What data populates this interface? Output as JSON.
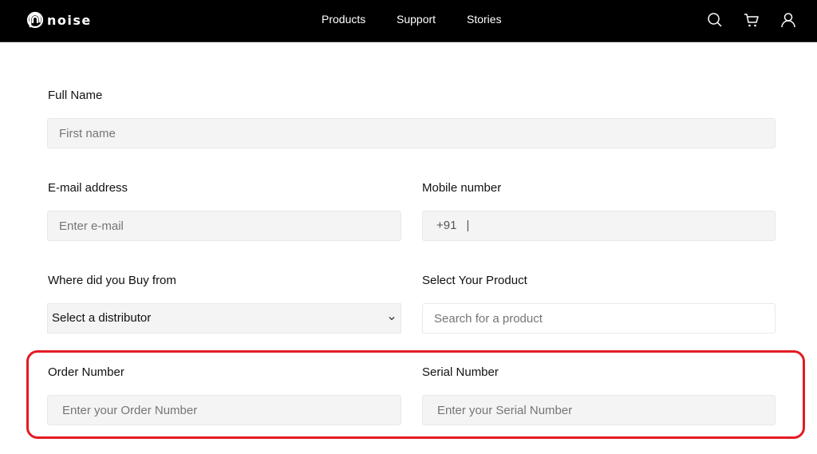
{
  "header": {
    "brand": "noise",
    "nav": [
      "Products",
      "Support",
      "Stories"
    ],
    "icons": [
      "search-icon",
      "cart-icon",
      "user-icon"
    ]
  },
  "form": {
    "full_name": {
      "label": "Full Name",
      "placeholder": "First name"
    },
    "email": {
      "label": "E-mail address",
      "placeholder": "Enter e-mail"
    },
    "mobile": {
      "label": "Mobile number",
      "prefix": "+91",
      "caret": "|"
    },
    "distributor": {
      "label": "Where did you Buy from",
      "selected": "Select a distributor"
    },
    "product": {
      "label": "Select Your Product",
      "placeholder": "Search for a product"
    },
    "order_number": {
      "label": "Order Number",
      "placeholder": "Enter your Order Number"
    },
    "serial_number": {
      "label": "Serial Number",
      "placeholder": "Enter your Serial Number"
    }
  },
  "colors": {
    "header_bg": "#000000",
    "field_bg": "#f4f4f4",
    "highlight": "#e31b23"
  }
}
